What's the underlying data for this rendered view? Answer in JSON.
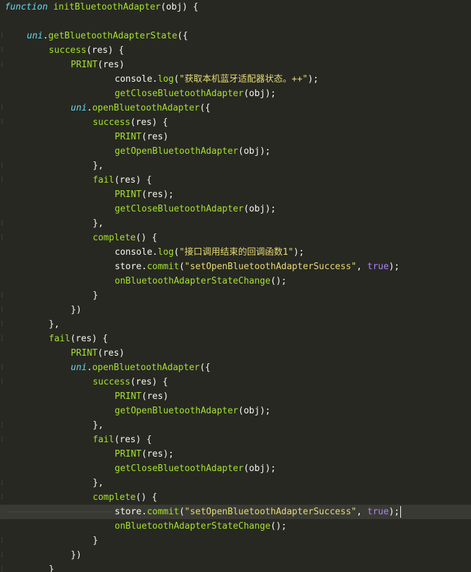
{
  "colors": {
    "background": "#272822",
    "keyword": "#66d9ef",
    "function": "#a6e22e",
    "string": "#e6db74",
    "literal": "#ae81ff",
    "plain": "#f8f8f2",
    "highlight_line": "#3a3a34"
  },
  "lines": [
    [
      {
        "t": "function",
        "c": "kw"
      },
      {
        "t": " ",
        "c": "pl"
      },
      {
        "t": "initBluetoothAdapter",
        "c": "fn"
      },
      {
        "t": "(obj) {",
        "c": "pl"
      }
    ],
    [],
    [
      {
        "t": "uni",
        "c": "obj"
      },
      {
        "t": ".",
        "c": "pl"
      },
      {
        "t": "getBluetoothAdapterState",
        "c": "fn"
      },
      {
        "t": "({",
        "c": "pl"
      }
    ],
    [
      {
        "t": "success",
        "c": "fn"
      },
      {
        "t": "(res) {",
        "c": "pl"
      }
    ],
    [
      {
        "t": "PRINT",
        "c": "fn"
      },
      {
        "t": "(res)",
        "c": "pl"
      }
    ],
    [
      {
        "t": "console.",
        "c": "pl"
      },
      {
        "t": "log",
        "c": "fn"
      },
      {
        "t": "(",
        "c": "pl"
      },
      {
        "t": "\"获取本机蓝牙适配器状态。++\"",
        "c": "str"
      },
      {
        "t": ");",
        "c": "pl"
      }
    ],
    [
      {
        "t": "getCloseBluetoothAdapter",
        "c": "fn"
      },
      {
        "t": "(obj);",
        "c": "pl"
      }
    ],
    [
      {
        "t": "uni",
        "c": "obj"
      },
      {
        "t": ".",
        "c": "pl"
      },
      {
        "t": "openBluetoothAdapter",
        "c": "fn"
      },
      {
        "t": "({",
        "c": "pl"
      }
    ],
    [
      {
        "t": "success",
        "c": "fn"
      },
      {
        "t": "(res) {",
        "c": "pl"
      }
    ],
    [
      {
        "t": "PRINT",
        "c": "fn"
      },
      {
        "t": "(res)",
        "c": "pl"
      }
    ],
    [
      {
        "t": "getOpenBluetoothAdapter",
        "c": "fn"
      },
      {
        "t": "(obj);",
        "c": "pl"
      }
    ],
    [
      {
        "t": "},",
        "c": "pl"
      }
    ],
    [
      {
        "t": "fail",
        "c": "fn"
      },
      {
        "t": "(res) {",
        "c": "pl"
      }
    ],
    [
      {
        "t": "PRINT",
        "c": "fn"
      },
      {
        "t": "(res);",
        "c": "pl"
      }
    ],
    [
      {
        "t": "getCloseBluetoothAdapter",
        "c": "fn"
      },
      {
        "t": "(obj);",
        "c": "pl"
      }
    ],
    [
      {
        "t": "},",
        "c": "pl"
      }
    ],
    [
      {
        "t": "complete",
        "c": "fn"
      },
      {
        "t": "() {",
        "c": "pl"
      }
    ],
    [
      {
        "t": "console.",
        "c": "pl"
      },
      {
        "t": "log",
        "c": "fn"
      },
      {
        "t": "(",
        "c": "pl"
      },
      {
        "t": "\"接口调用结束的回调函数1\"",
        "c": "str"
      },
      {
        "t": ");",
        "c": "pl"
      }
    ],
    [
      {
        "t": "store.",
        "c": "pl"
      },
      {
        "t": "commit",
        "c": "fn"
      },
      {
        "t": "(",
        "c": "pl"
      },
      {
        "t": "\"setOpenBluetoothAdapterSuccess\"",
        "c": "str"
      },
      {
        "t": ", ",
        "c": "pl"
      },
      {
        "t": "true",
        "c": "num"
      },
      {
        "t": ");",
        "c": "pl"
      }
    ],
    [
      {
        "t": "onBluetoothAdapterStateChange",
        "c": "fn"
      },
      {
        "t": "();",
        "c": "pl"
      }
    ],
    [
      {
        "t": "}",
        "c": "pl"
      }
    ],
    [
      {
        "t": "})",
        "c": "pl"
      }
    ],
    [
      {
        "t": "},",
        "c": "pl"
      }
    ],
    [
      {
        "t": "fail",
        "c": "fn"
      },
      {
        "t": "(res) {",
        "c": "pl"
      }
    ],
    [
      {
        "t": "PRINT",
        "c": "fn"
      },
      {
        "t": "(res)",
        "c": "pl"
      }
    ],
    [
      {
        "t": "uni",
        "c": "obj"
      },
      {
        "t": ".",
        "c": "pl"
      },
      {
        "t": "openBluetoothAdapter",
        "c": "fn"
      },
      {
        "t": "({",
        "c": "pl"
      }
    ],
    [
      {
        "t": "success",
        "c": "fn"
      },
      {
        "t": "(res) {",
        "c": "pl"
      }
    ],
    [
      {
        "t": "PRINT",
        "c": "fn"
      },
      {
        "t": "(res)",
        "c": "pl"
      }
    ],
    [
      {
        "t": "getOpenBluetoothAdapter",
        "c": "fn"
      },
      {
        "t": "(obj);",
        "c": "pl"
      }
    ],
    [
      {
        "t": "},",
        "c": "pl"
      }
    ],
    [
      {
        "t": "fail",
        "c": "fn"
      },
      {
        "t": "(res) {",
        "c": "pl"
      }
    ],
    [
      {
        "t": "PRINT",
        "c": "fn"
      },
      {
        "t": "(res);",
        "c": "pl"
      }
    ],
    [
      {
        "t": "getCloseBluetoothAdapter",
        "c": "fn"
      },
      {
        "t": "(obj);",
        "c": "pl"
      }
    ],
    [
      {
        "t": "},",
        "c": "pl"
      }
    ],
    [
      {
        "t": "complete",
        "c": "fn"
      },
      {
        "t": "() {",
        "c": "pl"
      }
    ],
    [
      {
        "t": "store.",
        "c": "pl"
      },
      {
        "t": "commit",
        "c": "fn"
      },
      {
        "t": "(",
        "c": "pl"
      },
      {
        "t": "\"setOpenBluetoothAdapterSuccess\"",
        "c": "str"
      },
      {
        "t": ", ",
        "c": "pl"
      },
      {
        "t": "true",
        "c": "num"
      },
      {
        "t": ");",
        "c": "pl"
      }
    ],
    [
      {
        "t": "onBluetoothAdapterStateChange",
        "c": "fn"
      },
      {
        "t": "();",
        "c": "pl"
      }
    ],
    [
      {
        "t": "}",
        "c": "pl"
      }
    ],
    [
      {
        "t": "})",
        "c": "pl"
      }
    ],
    [
      {
        "t": "}",
        "c": "pl"
      }
    ]
  ]
}
